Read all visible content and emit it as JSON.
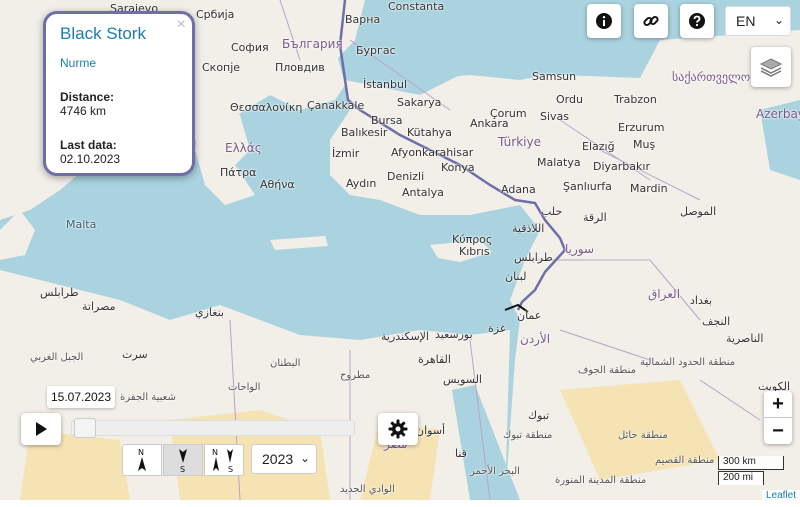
{
  "popup": {
    "close": "×",
    "title": "Black Stork",
    "name_link": "Nurme",
    "distance_label": "Distance:",
    "distance_value": "4746 km",
    "last_data_label": "Last data:",
    "last_data_value": "02.10.2023"
  },
  "language": {
    "selected": "EN"
  },
  "zoom": {
    "in": "+",
    "out": "−"
  },
  "scale": {
    "metric": "300 km",
    "imperial": "200 mi"
  },
  "attribution": "Leaflet",
  "playback": {
    "date": "15.07.2023",
    "position": 0.0
  },
  "year": {
    "selected": "2023"
  },
  "colors": {
    "track": "#6e6ea8",
    "sea": "#aad3df",
    "land": "#f2efe9",
    "desert": "#f5e3b3"
  },
  "map_labels": {
    "sarajevo": "Sarajevo",
    "srbija": "Србија",
    "varna": "Варна",
    "constanta": "Constanta",
    "sofia": "София",
    "bulgaria": "България",
    "burgas": "Бургас",
    "skopje": "Скопје",
    "plovdiv": "Пловдив",
    "istanbul": "İstanbul",
    "samsun": "Samsun",
    "ordu": "Ordu",
    "trabzon": "Trabzon",
    "sakartvelo": "საქართველო",
    "azerbay": "Azerbay",
    "thessaloniki": "Θεσσαλονίκη",
    "canakkale": "Çanakkale",
    "bursa": "Bursa",
    "sakarya": "Sakarya",
    "ankara": "Ankara",
    "corum": "Çorum",
    "sivas": "Sivas",
    "erzurum": "Erzurum",
    "balikesir": "Balıkesir",
    "kutahya": "Kütahya",
    "turkiye": "Türkiye",
    "mus": "Muş",
    "ellada": "Ελλάς",
    "izmir": "İzmir",
    "afyon": "Afyonkarahisar",
    "konya": "Konya",
    "malatya": "Malatya",
    "elazig": "Elazığ",
    "diyarbakir": "Diyarbakır",
    "patra": "Πάτρα",
    "athina": "Αθήνα",
    "aydin": "Aydın",
    "denizli": "Denizli",
    "adana": "Adana",
    "sanliurfa": "Şanlıurfa",
    "mardin": "Mardin",
    "antalya": "Antalya",
    "halab": "حلب",
    "raqqa": "الرقة",
    "mosul": "الموصل",
    "malta": "Malta",
    "ladhiqiya": "اللاذقية",
    "suriya": "سوريا",
    "kypros": "Κύπρος",
    "kibris": "Kıbrıs",
    "tarabulus_lb": "طرابلس",
    "lubnan": "لبنان",
    "iraq": "العراق",
    "baghdad": "بغداد",
    "tarabulus_ly": "طرابلس",
    "misrata": "مصراتة",
    "benghazi": "بنغازي",
    "gaza": "غزة",
    "amman": "عمان",
    "iskandariya": "الإسكندرية",
    "bur_said": "بورسعيد",
    "urdun": "الأردن",
    "qahira": "القاهرة",
    "suways": "السويس",
    "najaf": "النجف",
    "kuwait": "الكويت",
    "tabuk": "تبوك",
    "aswan": "أسوان",
    "hail": "منطقة حائل",
    "qassim": "منطقة القصيم",
    "medina": "منطقة المدينة المنورة",
    "misr": "مصر",
    "sirte": "سرت",
    "jufra": "شعبية الجفرة",
    "wahat": "الواحات",
    "butnan": "البطنان",
    "matruh": "مطروح",
    "jawf": "منطقة الجوف",
    "qina": "قنا",
    "huduud": "منطقة الحدود الشمالية",
    "bahr_ahmar": "البحر الأحمر",
    "wadi_jadid": "الوادي الجديد",
    "tabuk_reg": "منطقة تبوك",
    "nasiriya": "الناصرية",
    "jabal_gharbi": "الجبل الغربي"
  }
}
